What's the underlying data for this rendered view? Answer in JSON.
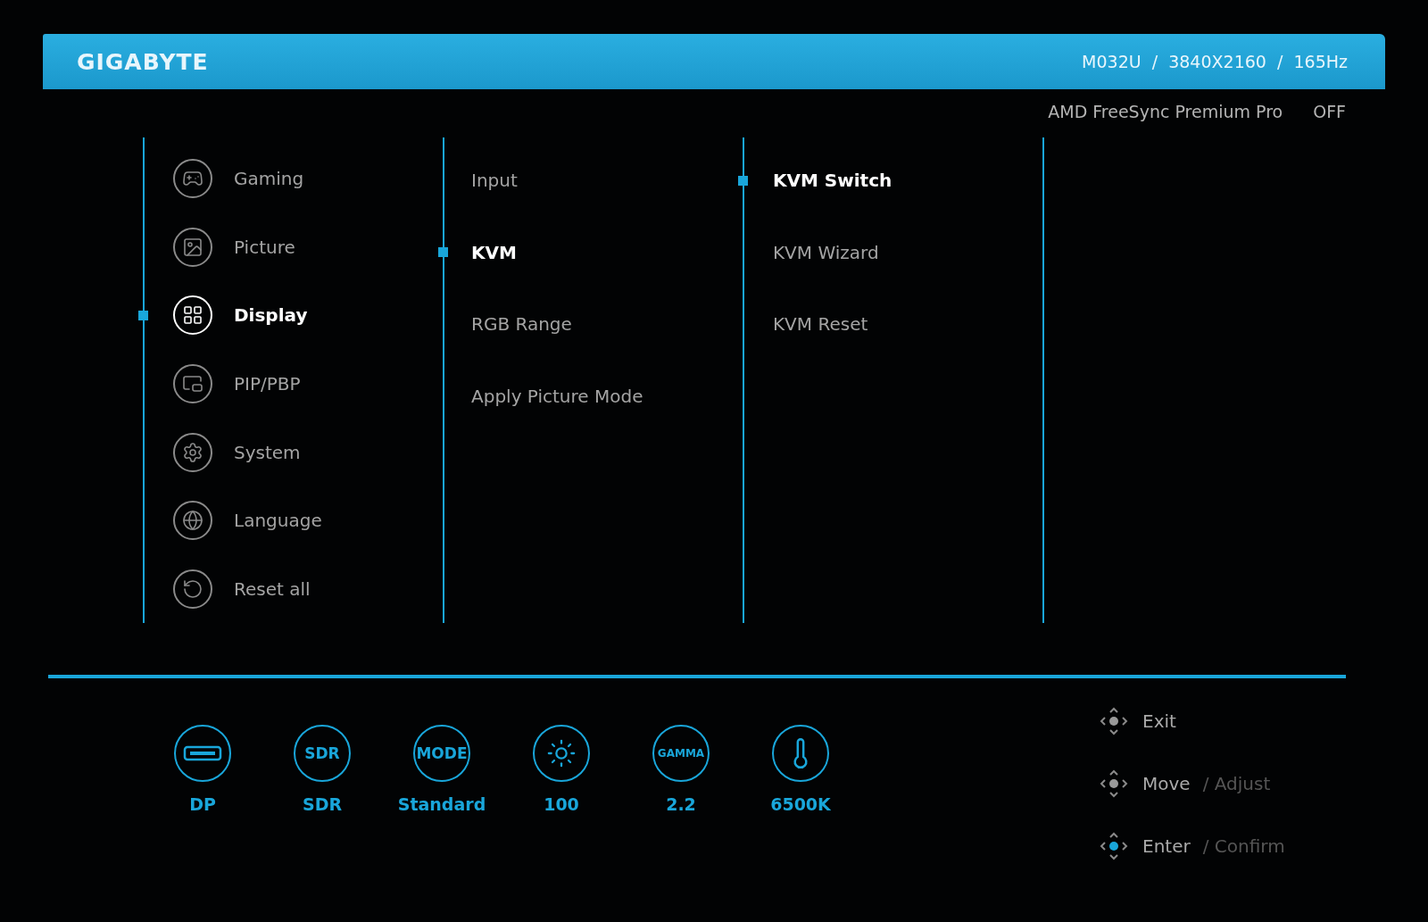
{
  "header": {
    "brand": "GIGABYTE",
    "model_info": "M032U  /  3840X2160  /  165Hz"
  },
  "status": {
    "label": "AMD FreeSync Premium Pro",
    "value": "OFF"
  },
  "menu": [
    {
      "kind": "gaming",
      "label": "Gaming",
      "selected": false
    },
    {
      "kind": "picture",
      "label": "Picture",
      "selected": false
    },
    {
      "kind": "display",
      "label": "Display",
      "selected": true
    },
    {
      "kind": "pip",
      "label": "PIP/PBP",
      "selected": false
    },
    {
      "kind": "system",
      "label": "System",
      "selected": false
    },
    {
      "kind": "language",
      "label": "Language",
      "selected": false
    },
    {
      "kind": "reset",
      "label": "Reset all",
      "selected": false
    }
  ],
  "submenu": [
    {
      "label": "Input",
      "selected": false
    },
    {
      "label": "KVM",
      "selected": true
    },
    {
      "label": "RGB Range",
      "selected": false
    },
    {
      "label": "Apply Picture Mode",
      "selected": false
    }
  ],
  "options": [
    {
      "label": "KVM Switch",
      "selected": true
    },
    {
      "label": "KVM Wizard",
      "selected": false
    },
    {
      "label": "KVM Reset",
      "selected": false
    }
  ],
  "quick_settings": [
    {
      "kind": "port",
      "label": "DP"
    },
    {
      "kind": "badge",
      "badge": "SDR",
      "label": "SDR"
    },
    {
      "kind": "badge",
      "badge": "MODE",
      "label": "Standard"
    },
    {
      "kind": "brightness",
      "label": "100"
    },
    {
      "kind": "badge",
      "badge": "GAMMA",
      "label": "2.2"
    },
    {
      "kind": "temperature",
      "label": "6500K"
    }
  ],
  "hints": [
    {
      "kind": "exit",
      "label": "Exit"
    },
    {
      "kind": "move",
      "label": "Move",
      "secondary": "/ Adjust"
    },
    {
      "kind": "enter",
      "label": "Enter",
      "secondary": "/ Confirm"
    }
  ]
}
